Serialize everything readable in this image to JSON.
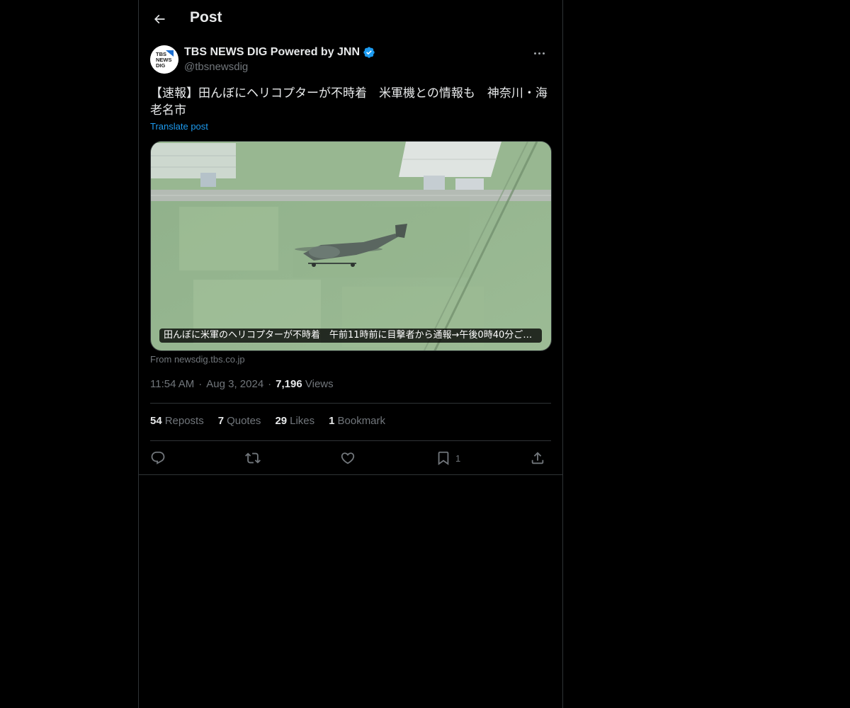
{
  "header": {
    "title": "Post",
    "back_icon": "arrow-left-icon"
  },
  "author": {
    "name": "TBS NEWS DIG Powered by JNN",
    "handle": "@tbsnewsdig",
    "avatar_text": [
      "TBS",
      "NEWS",
      "DIG"
    ],
    "verified_color": "#1d9bf0"
  },
  "post": {
    "text": "【速報】田んぼにヘリコプターが不時着　米軍機との情報も　神奈川・海老名市",
    "translate_label": "Translate post",
    "media_caption": "田んぼに米軍のヘリコプターが不時着　午前11時前に目撃者から通報→午後0時40分ごろ…",
    "source": "From newsdig.tbs.co.jp"
  },
  "meta": {
    "time": "11:54 AM",
    "date": "Aug 3, 2024",
    "views_count": "7,196",
    "views_label": "Views",
    "separator": "·"
  },
  "stats": {
    "reposts_count": "54",
    "reposts_label": "Reposts",
    "quotes_count": "7",
    "quotes_label": "Quotes",
    "likes_count": "29",
    "likes_label": "Likes",
    "bookmarks_count": "1",
    "bookmarks_label": "Bookmark"
  },
  "actions": {
    "reply_icon": "reply-icon",
    "repost_icon": "repost-icon",
    "like_icon": "heart-icon",
    "bookmark_icon": "bookmark-icon",
    "bookmark_count": "1",
    "share_icon": "share-icon"
  },
  "colors": {
    "accent": "#1d9bf0",
    "background": "#000000",
    "muted": "#71767b",
    "border": "#2f3336"
  }
}
